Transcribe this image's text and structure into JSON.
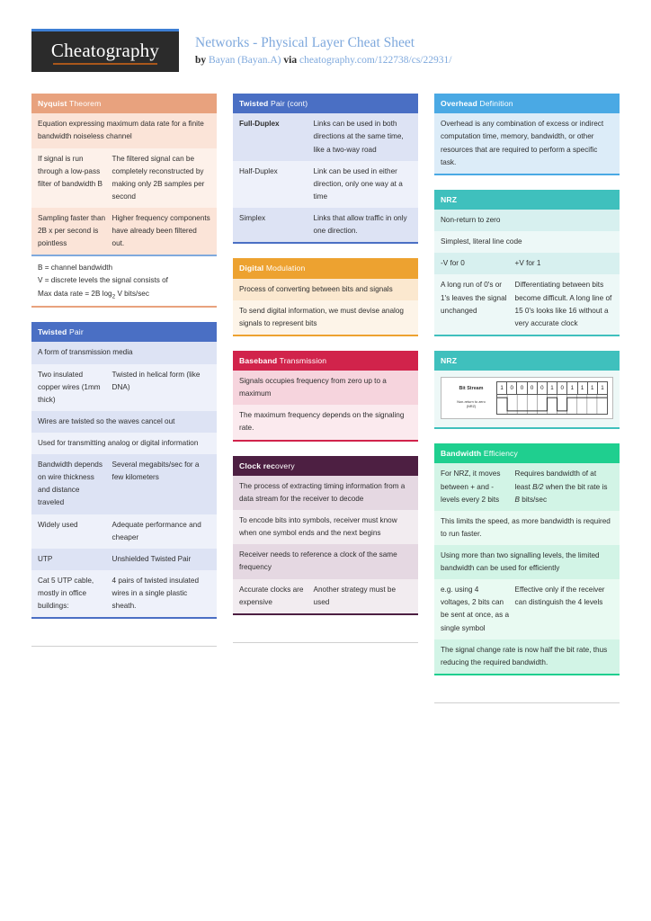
{
  "header": {
    "logo": "Cheatography",
    "title": "Networks - Physical Layer Cheat Sheet",
    "by_prefix": "by ",
    "author": "Bayan (Bayan.A)",
    "via": " via ",
    "source_url": "cheatography.com/122738/cs/22931/"
  },
  "colors": {
    "logo_bg": "#2b2b2b",
    "logo_accent": "#3d7fd4",
    "link_blue": "#7fa9dd",
    "salmon": "#e8a27e",
    "salmon_light": "#fbe4d8",
    "salmon_lighter": "#fdf1ea",
    "blue": "#4a6fc4",
    "blue_light": "#dde3f4",
    "blue_lighter": "#eef1fa",
    "orange": "#eda230",
    "orange_light": "#fbe8cf",
    "orange_lighter": "#fdf4e8",
    "crimson": "#d1234b",
    "crimson_light": "#f6d4dd",
    "crimson_lighter": "#fbeaee",
    "plum": "#4d1f42",
    "plum_light": "#e5d8e2",
    "plum_lighter": "#f2ecf0",
    "sky": "#4aa9e4",
    "sky_light": "#dcecf8",
    "sky_lighter": "#eef5fc",
    "teal": "#3fc0bd",
    "teal_light": "#d7f0ef",
    "teal_lighter": "#edf8f7",
    "green": "#1fcf8f",
    "green_light": "#d2f4e6",
    "green_lighter": "#e9faf2"
  },
  "columns": [
    {
      "cards": [
        {
          "name": "nyquist-theorem",
          "title": "Nyquist Theorem",
          "title_bold": "Nyquist",
          "title_rest": " Theorem",
          "theme": "salmon",
          "rows": [
            {
              "type": "single",
              "text": "Equation expressing maximum data rate for a finite bandwidth noiseless channel"
            },
            {
              "type": "pair",
              "a": "If signal is run through a low-pass filter of bandwidth B",
              "b": "The filtered signal can be completely reconstructed by making only 2B samples per second"
            },
            {
              "type": "pair",
              "a": "Sampling faster than 2B x per second is pointless",
              "b": "Higher frequency components have already been filtered out."
            }
          ],
          "footnote": {
            "lines": [
              "B = channel bandwidth",
              "V = discrete levels the signal consists of",
              "Max data rate = 2B log2 V bits/sec"
            ],
            "border_color": "#7fa9dd"
          }
        },
        {
          "name": "twisted-pair",
          "title": "Twisted Pair",
          "title_bold": "Twisted",
          "title_rest": " Pair",
          "theme": "blue",
          "rows": [
            {
              "type": "single",
              "text": "A form of transmission media"
            },
            {
              "type": "pair",
              "a": "Two insulated copper wires (1mm thick)",
              "b": "Twisted in helical form (like DNA)"
            },
            {
              "type": "single",
              "text": "Wires are twisted so the waves cancel out"
            },
            {
              "type": "single",
              "text": "Used for transmitting analog or digital information"
            },
            {
              "type": "pair",
              "a": "Bandwidth depends on wire thickness and distance traveled",
              "b": "Several megabits/sec for a few kilometers"
            },
            {
              "type": "pair",
              "a": "Widely used",
              "b": "Adequate perfor­mance and cheaper"
            },
            {
              "type": "pair",
              "a": "UTP",
              "b": "Unshielded Twisted Pair"
            },
            {
              "type": "pair",
              "a": "Cat 5 UTP cable, mostly in office buildings:",
              "b": "4 pairs of twisted insulated wires in a single plastic sheath."
            }
          ]
        }
      ]
    },
    {
      "cards": [
        {
          "name": "twisted-pair-cont",
          "title": "Twisted Pair (cont)",
          "title_bold": "Twisted",
          "title_rest": " Pair (cont)",
          "theme": "blue",
          "rows": [
            {
              "type": "pair",
              "a": "Full-D­uplex",
              "a_bold": true,
              "b": "Links can be used in both directions at the same time, like a two-way road"
            },
            {
              "type": "pair",
              "a": "Half-D­uplex",
              "b": "Link can be used in either direction, only one way at a time"
            },
            {
              "type": "pair",
              "a": "Simplex",
              "b": "Links that allow traffic in only one direction."
            }
          ]
        },
        {
          "name": "digital-modulation",
          "title": "Digital Modulation",
          "title_bold": "Digital",
          "title_rest": " Modulation",
          "theme": "orange",
          "rows": [
            {
              "type": "single",
              "text": "Process of converting between bits and signals"
            },
            {
              "type": "single",
              "text": "To send digital information, we must devise analog signals to represent bits"
            }
          ]
        },
        {
          "name": "baseband-transmission",
          "title": "Baseband Transmission",
          "title_bold": "Baseband",
          "title_rest": " Transmission",
          "theme": "crimson",
          "rows": [
            {
              "type": "single",
              "text": "Signals occupies frequency from zero up to a maximum"
            },
            {
              "type": "single",
              "text": "The maximum frequency depends on the signaling rate."
            }
          ]
        },
        {
          "name": "clock-recovery",
          "title": "Clock recovery",
          "title_bold": "Clock rec",
          "title_rest": "overy",
          "theme": "plum",
          "rows": [
            {
              "type": "single",
              "text": "The process of extracting timing information from a data stream for the receiver to decode"
            },
            {
              "type": "single",
              "text": "To encode bits into symbols, receiver must know when one symbol ends and the next begins"
            },
            {
              "type": "single",
              "text": "Receiver needs to reference a clock of the same frequency"
            },
            {
              "type": "pair",
              "a": "Accurate clocks are expensive",
              "b": "Another strategy must be used"
            }
          ]
        }
      ]
    },
    {
      "cards": [
        {
          "name": "overhead-definition",
          "title": "Overhead Definition",
          "title_bold": "Overhead",
          "title_rest": " Definition",
          "theme": "sky",
          "rows": [
            {
              "type": "single",
              "text": "Overhead is any combination of excess or indirect computation time, memory, bandwidth, or other resources that are required to perform a specific task."
            }
          ]
        },
        {
          "name": "nrz",
          "title": "NRZ",
          "title_bold": "NRZ",
          "title_rest": "",
          "theme": "teal",
          "rows": [
            {
              "type": "single",
              "text": "Non-return to zero"
            },
            {
              "type": "single",
              "text": "Simplest, literal line code"
            },
            {
              "type": "pair",
              "a": "-V for 0",
              "b": "+V for 1"
            },
            {
              "type": "pair",
              "a": "A long run of 0's or 1's leaves the signal unchanged",
              "b": "Differentiating between bits become difficult. A long line of 15 0's looks like 16 without a very accurate clock"
            }
          ]
        },
        {
          "name": "nrz-diagram",
          "title": "NRZ",
          "title_bold": "NRZ",
          "title_rest": "",
          "theme": "teal",
          "diagram": {
            "label_top": "Bit Stream",
            "label_bottom_line1": "Non-return to zero",
            "label_bottom_line2": "(NRZ)",
            "bits": [
              "1",
              "0",
              "0",
              "0",
              "0",
              "1",
              "0",
              "1",
              "1",
              "1",
              "1"
            ]
          }
        },
        {
          "name": "bandwidth-efficiency",
          "title": "Bandwidth Efficiency",
          "title_bold": "Bandwidth",
          "title_rest": " Efficiency",
          "theme": "green",
          "rows": [
            {
              "type": "pair",
              "a": "For NRZ, it moves between + and - levels every 2 bits",
              "b": "Requires bandwidth of at least B/2 when the bit rate is B bits/sec",
              "b_italic_tokens": [
                "B/2",
                "B"
              ]
            },
            {
              "type": "single",
              "text": "This limits the speed, as more bandwidth is required to run faster."
            },
            {
              "type": "single",
              "text": "Using more than two signalling levels, the limited bandwidth can be used for efficiently"
            },
            {
              "type": "pair",
              "a": "e.g. using 4 voltages, 2 bits can be sent at once, as a single symbol",
              "b": "Effective only if the receiver can distin­guish the 4 levels"
            },
            {
              "type": "single",
              "text": "The signal change rate is now half the bit rate, thus reducing the required bandwidth."
            }
          ]
        }
      ]
    }
  ]
}
